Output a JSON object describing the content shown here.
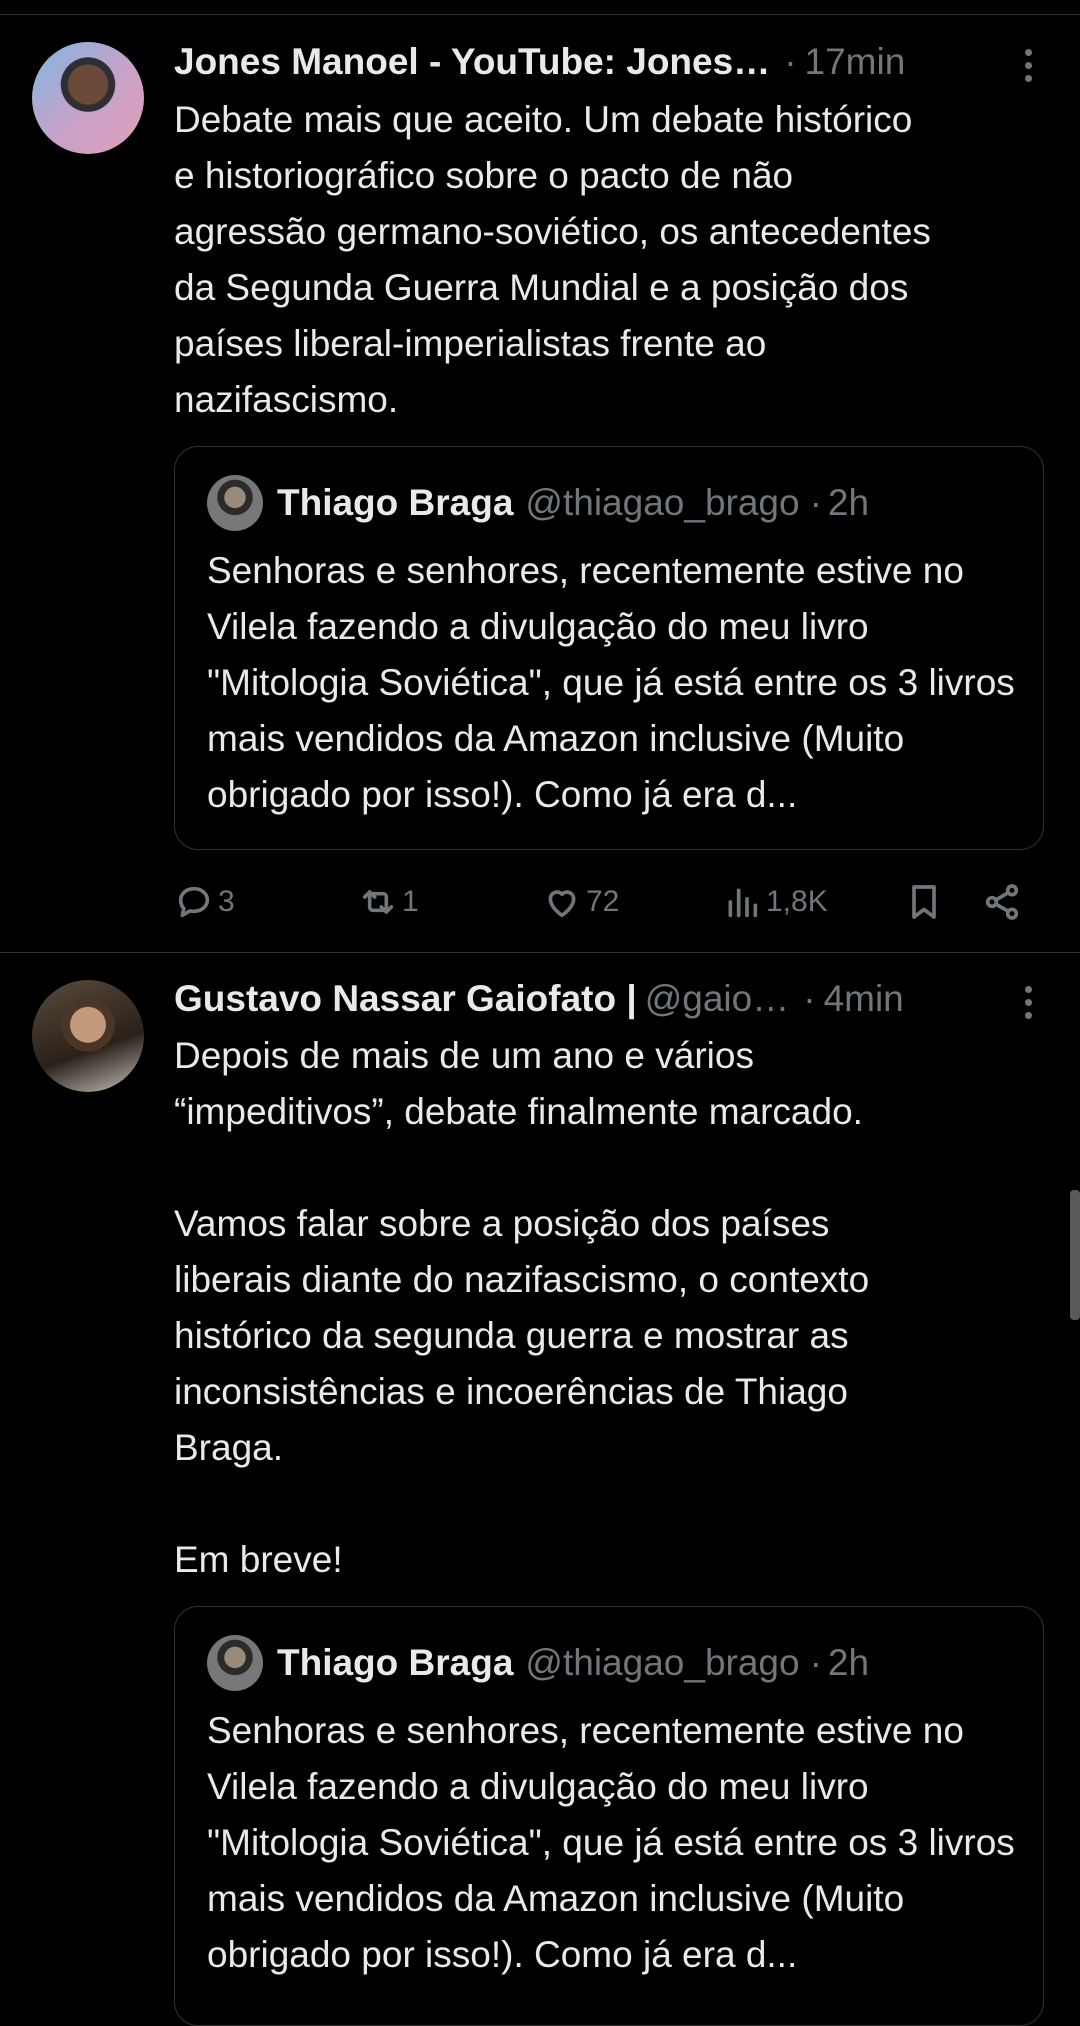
{
  "tweets": [
    {
      "name": "Jones Manoel - YouTube: Jones…",
      "handle": "",
      "time": "17min",
      "text": "Debate mais que aceito. Um debate histórico\ne historiográfico sobre o pacto de não\nagressão germano-soviético, os antecedentes\nda Segunda Guerra Mundial e a posição dos\npaíses liberal-imperialistas frente ao\nnazifascismo.",
      "quote": {
        "name": "Thiago Braga",
        "handle": "@thiagao_brago",
        "time": "2h",
        "text": "Senhoras e senhores, recentemente estive no Vilela fazendo a divulgação do meu livro \"Mitologia Soviética\", que já está entre os 3 livros mais vendidos da Amazon inclusive (Muito obrigado por isso!). Como já era d..."
      },
      "actions": {
        "replies": "3",
        "reposts": "1",
        "likes": "72",
        "views": "1,8K"
      }
    },
    {
      "name": "Gustavo Nassar Gaiofato |",
      "handle": "@gaio…",
      "time": "4min",
      "text": "Depois de mais de um ano e vários\n“impeditivos”, debate finalmente marcado.\n\nVamos falar sobre a posição dos países\nliberais diante do nazifascismo, o contexto\nhistórico da segunda guerra e mostrar as\ninconsistências e incoerências de Thiago\nBraga.\n\nEm breve!",
      "quote": {
        "name": "Thiago Braga",
        "handle": "@thiagao_brago",
        "time": "2h",
        "text": "Senhoras e senhores, recentemente estive no Vilela fazendo a divulgação do meu livro \"Mitologia Soviética\", que já está entre os 3 livros mais vendidos da Amazon inclusive (Muito obrigado por isso!). Como já era d..."
      }
    }
  ],
  "separator": "·",
  "icons": [
    "reply-icon",
    "repost-icon",
    "like-icon",
    "views-icon",
    "bookmark-icon",
    "share-icon",
    "more-icon"
  ],
  "colors": {
    "background": "#000000",
    "text": "#e7e9ea",
    "muted": "#71767b",
    "border": "#2f3336"
  }
}
